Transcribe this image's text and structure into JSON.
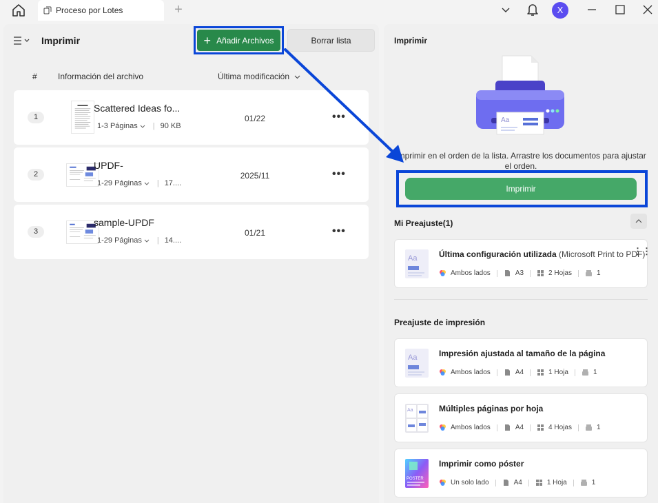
{
  "tab": {
    "title": "Proceso por Lotes"
  },
  "titlebar": {
    "avatar_letter": "X"
  },
  "left": {
    "title": "Imprimir",
    "add_label": "Añadir Archivos",
    "clear_label": "Borrar lista",
    "col_num": "#",
    "col_info": "Información del archivo",
    "col_modified": "Última modificación",
    "files": [
      {
        "index": "1",
        "name": "Scattered Ideas fo...",
        "pages": "1-3 Páginas",
        "size": "90 KB",
        "date": "01/22"
      },
      {
        "index": "2",
        "name": "UPDF-",
        "pages": "1-29 Páginas",
        "size": "17....",
        "date": "2025/11"
      },
      {
        "index": "3",
        "name": "sample-UPDF",
        "pages": "1-29 Páginas",
        "size": "14....",
        "date": "01/21"
      }
    ]
  },
  "right": {
    "title": "Imprimir",
    "description": "Imprimir en el orden de la lista. Arrastre los documentos para ajustar el orden.",
    "print_label": "Imprimir",
    "my_presets_title": "Mi Preajuste",
    "my_presets_count": "(1)",
    "my_presets": [
      {
        "title": "Última configuración utilizada",
        "printer": "(Microsoft Print to PDF)",
        "sides": "Ambos lados",
        "paper": "A3",
        "sheets": "2 Hojas",
        "copies": "1"
      }
    ],
    "print_presets_title": "Preajuste de impresión",
    "print_presets": [
      {
        "title": "Impresión ajustada al tamaño de la página",
        "sides": "Ambos lados",
        "paper": "A4",
        "sheets": "1 Hoja",
        "copies": "1"
      },
      {
        "title": "Múltiples páginas por hoja",
        "sides": "Ambos lados",
        "paper": "A4",
        "sheets": "4 Hojas",
        "copies": "1"
      },
      {
        "title": "Imprimir como póster",
        "sides": "Un solo lado",
        "paper": "A4",
        "sheets": "1 Hoja",
        "copies": "1",
        "thumb_label": "POSTER"
      }
    ]
  },
  "colors": {
    "green_add": "#28894a",
    "green_print": "#45a868",
    "highlight_blue": "#0a46d8",
    "avatar": "#5a4cf0"
  }
}
